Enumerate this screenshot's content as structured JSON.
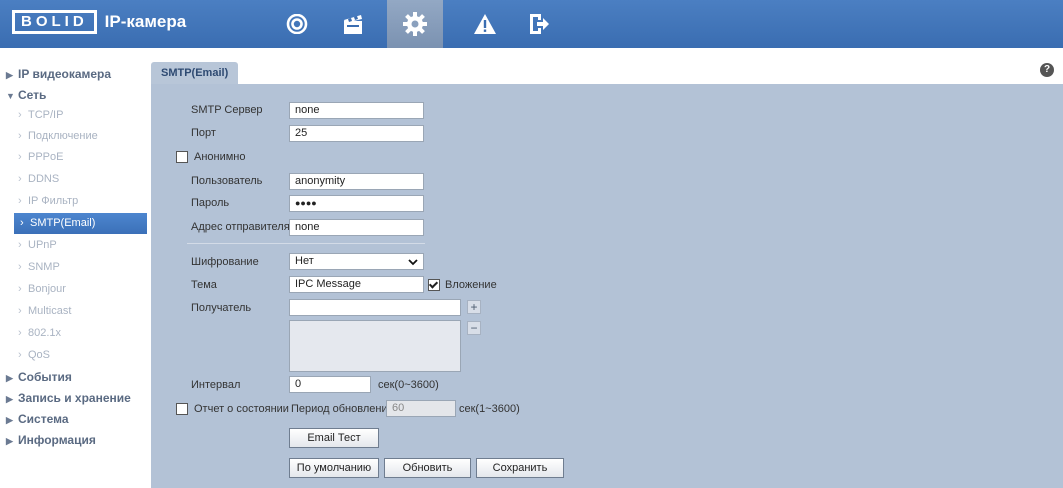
{
  "header": {
    "logo": "BOLID",
    "title": "IP-камера",
    "nav": [
      {
        "icon": "eye-icon"
      },
      {
        "icon": "clapperboard-icon"
      },
      {
        "icon": "gear-icon",
        "active": true
      },
      {
        "icon": "warning-icon"
      },
      {
        "icon": "exit-icon"
      }
    ]
  },
  "sidebar": {
    "groups": [
      {
        "label": "IP видеокамера",
        "expanded": false
      },
      {
        "label": "Сеть",
        "expanded": true
      },
      {
        "label": "События",
        "expanded": false
      },
      {
        "label": "Запись и хранение",
        "expanded": false
      },
      {
        "label": "Система",
        "expanded": false
      },
      {
        "label": "Информация",
        "expanded": false
      }
    ],
    "network_items": [
      "TCP/IP",
      "Подключение",
      "PPPoE",
      "DDNS",
      "IP Фильтр",
      "SMTP(Email)",
      "UPnP",
      "SNMP",
      "Bonjour",
      "Multicast",
      "802.1x",
      "QoS"
    ],
    "active_item": "SMTP(Email)"
  },
  "tab": {
    "label": "SMTP(Email)",
    "help": "?"
  },
  "form": {
    "smtp_server_label": "SMTP Сервер",
    "smtp_server_value": "none",
    "port_label": "Порт",
    "port_value": "25",
    "anonymous_label": "Анонимно",
    "anonymous_checked": false,
    "user_label": "Пользователь",
    "user_value": "anonymity",
    "password_label": "Пароль",
    "password_value": "●●●●",
    "sender_label": "Адрес отправителя",
    "sender_value": "none",
    "encryption_label": "Шифрование",
    "encryption_value": "Нет",
    "subject_label": "Тема",
    "subject_value": "IPC Message",
    "attachment_label": "Вложение",
    "attachment_checked": true,
    "recipient_label": "Получатель",
    "recipient_value": "",
    "add_symbol": "+",
    "remove_symbol": "−",
    "interval_label": "Интервал",
    "interval_value": "0",
    "interval_hint": "сек(0~3600)",
    "health_label": "Отчет о состоянии",
    "health_checked": false,
    "update_period_label": "Период обновления",
    "update_period_value": "60",
    "update_period_hint": "сек(1~3600)"
  },
  "buttons": {
    "email_test": "Email Тест",
    "default": "По умолчанию",
    "refresh": "Обновить",
    "save": "Сохранить"
  }
}
